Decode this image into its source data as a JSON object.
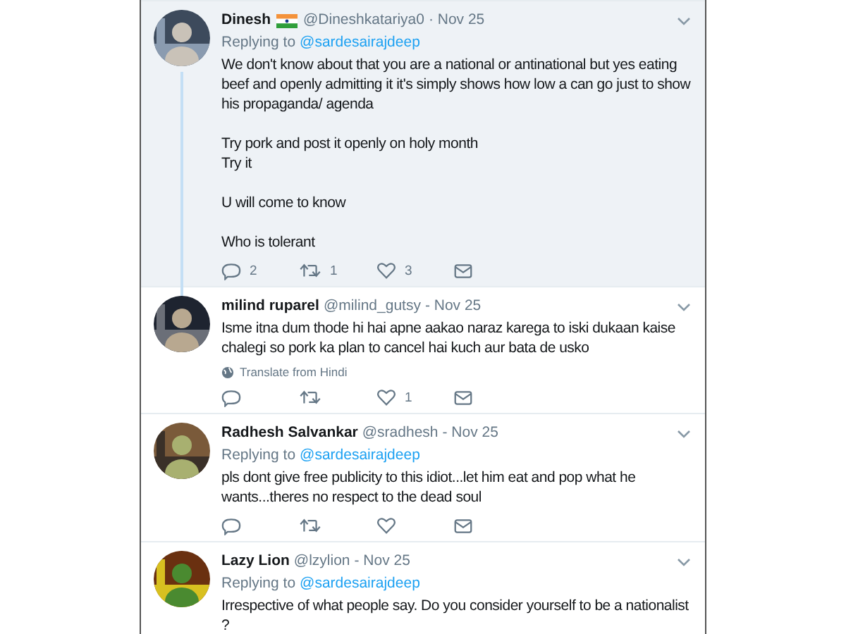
{
  "tweets": [
    {
      "name": "Dinesh",
      "flag": true,
      "handle": "@Dineshkatariya0",
      "date": "· Nov 25",
      "replying_prefix": "Replying to",
      "replying_to": "@sardesairajdeep",
      "highlighted": true,
      "threaded": true,
      "paragraphs": [
        "We don't know about that you are a national or antinational but yes eating beef and openly admitting it it's simply shows how low a can go just to show his propaganda/ agenda",
        "Try pork and post it openly on holy month\nTry it",
        "U will come to know",
        "Who is tolerant"
      ],
      "actions": [
        {
          "kind": "reply",
          "count": "2"
        },
        {
          "kind": "retweet",
          "count": "1"
        },
        {
          "kind": "like",
          "count": "3"
        },
        {
          "kind": "message"
        }
      ]
    },
    {
      "name": "milind ruparel",
      "handle": "@milind_gutsy",
      "date": "- Nov 25",
      "highlighted": false,
      "paragraphs": [
        "Isme itna dum thode hi hai apne aakao naraz karega to iski dukaan kaise chalegi so pork ka plan to cancel hai kuch aur bata de usko"
      ],
      "translate": "Translate from Hindi",
      "actions": [
        {
          "kind": "reply"
        },
        {
          "kind": "retweet"
        },
        {
          "kind": "like",
          "count": "1"
        },
        {
          "kind": "message"
        }
      ]
    },
    {
      "name": "Radhesh Salvankar",
      "handle": "@sradhesh",
      "date": "- Nov 25",
      "replying_prefix": "Replying to",
      "replying_to": "@sardesairajdeep",
      "highlighted": false,
      "paragraphs": [
        "pls dont give free publicity to this idiot...let him eat and pop what he wants...theres no respect to the dead soul"
      ],
      "actions": [
        {
          "kind": "reply"
        },
        {
          "kind": "retweet"
        },
        {
          "kind": "like"
        },
        {
          "kind": "message"
        }
      ]
    },
    {
      "name": "Lazy Lion",
      "handle": "@lzylion",
      "date": "- Nov 25",
      "replying_prefix": "Replying to",
      "replying_to": "@sardesairajdeep",
      "highlighted": false,
      "paragraphs": [
        "Irrespective of what people say. Do you consider yourself to be a nationalist ?"
      ]
    }
  ]
}
